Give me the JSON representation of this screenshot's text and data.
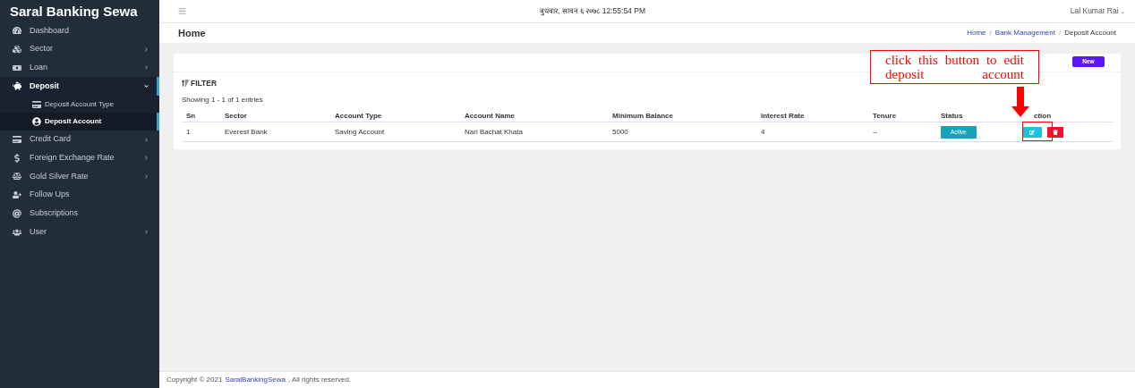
{
  "sidebar": {
    "brand": "Saral Banking Sewa",
    "items": [
      {
        "label": "Dashboard",
        "kind": "link",
        "selected": false
      },
      {
        "label": "Sector",
        "kind": "menu",
        "expanded": false,
        "selected": false
      },
      {
        "label": "Loan",
        "kind": "menu",
        "expanded": false,
        "selected": false
      },
      {
        "label": "Deposit",
        "kind": "menu",
        "expanded": true,
        "selected": true,
        "children": [
          {
            "label": "Deposit Account Type",
            "selected": false
          },
          {
            "label": "Deposit Account",
            "selected": true
          }
        ]
      },
      {
        "label": "Credit Card",
        "kind": "menu",
        "expanded": false,
        "selected": false
      },
      {
        "label": "Foreign Exchange Rate",
        "kind": "menu",
        "expanded": false,
        "selected": false
      },
      {
        "label": "Gold Silver Rate",
        "kind": "menu",
        "expanded": false,
        "selected": false
      },
      {
        "label": "Follow Ups",
        "kind": "link",
        "selected": false
      },
      {
        "label": "Subscriptions",
        "kind": "link",
        "selected": false
      },
      {
        "label": "User",
        "kind": "menu",
        "expanded": false,
        "selected": false
      }
    ]
  },
  "topbar": {
    "datetime": "बुधवार, सावन ६ २०७८ 12:55:54 PM",
    "user": "Lal Kumar Rai",
    "user_caret": "⌄"
  },
  "page": {
    "title": "Home",
    "breadcrumb": [
      "Home",
      "Bank Management",
      "Deposit Account"
    ],
    "breadcrumb_separators": [
      "/",
      "/"
    ]
  },
  "card": {
    "new_button": "New",
    "filter": "FILTER",
    "showing": "Showing 1 - 1 of 1 entries",
    "table": {
      "columns": [
        "Sn",
        "Sector",
        "Account Type",
        "Account Name",
        "Minimum Balance",
        "Interest Rate",
        "Tenure",
        "Status",
        "ction"
      ],
      "rows": [
        {
          "sn": "1",
          "sector": "Everest Bank",
          "account_type": "Saving Account",
          "account_name": "Nari Bachat Khata",
          "minimum_balance": "5000",
          "interest_rate": "4",
          "tenure": "--",
          "status": "Active"
        }
      ]
    }
  },
  "annotation": {
    "text": "click this button to edit deposit account"
  },
  "footer": {
    "before": "Copyright © 2021",
    "link": "SaralBankingSewa",
    "after": ", All rights reserved."
  }
}
